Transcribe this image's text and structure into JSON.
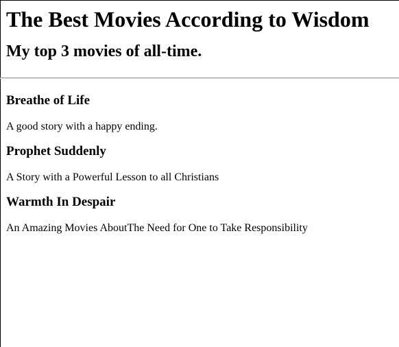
{
  "page": {
    "title": "The Best Movies According to Wisdom",
    "subtitle": "My top 3 movies of all-time."
  },
  "movies": [
    {
      "title": "Breathe of Life",
      "description": "A good story with a happy ending."
    },
    {
      "title": "Prophet Suddenly",
      "description": "A Story with a Powerful Lesson to all Christians"
    },
    {
      "title": "Warmth In Despair",
      "description": "An Amazing Movies AboutThe Need for One to Take Responsibility"
    }
  ]
}
